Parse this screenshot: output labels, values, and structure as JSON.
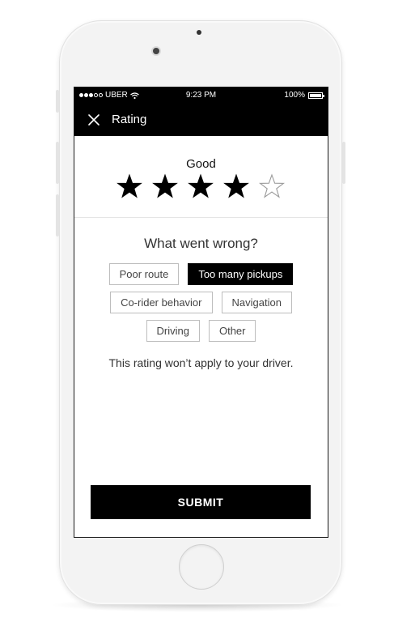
{
  "status_bar": {
    "carrier": "UBER",
    "time": "9:23 PM",
    "battery": "100%",
    "signal_dots": [
      true,
      true,
      true,
      false,
      false
    ]
  },
  "header": {
    "title": "Rating",
    "close_icon": "close-icon"
  },
  "rating": {
    "label": "Good",
    "value": 4,
    "max": 5
  },
  "feedback": {
    "question": "What went wrong?",
    "options": [
      {
        "label": "Poor route",
        "selected": false
      },
      {
        "label": "Too many pickups",
        "selected": true
      },
      {
        "label": "Co-rider behavior",
        "selected": false
      },
      {
        "label": "Navigation",
        "selected": false
      },
      {
        "label": "Driving",
        "selected": false
      },
      {
        "label": "Other",
        "selected": false
      }
    ],
    "note": "This rating won’t apply to your driver."
  },
  "actions": {
    "submit_label": "SUBMIT"
  },
  "colors": {
    "header_bg": "#000000",
    "selected_chip": "#000000",
    "chip_border": "#bdbdbd"
  }
}
